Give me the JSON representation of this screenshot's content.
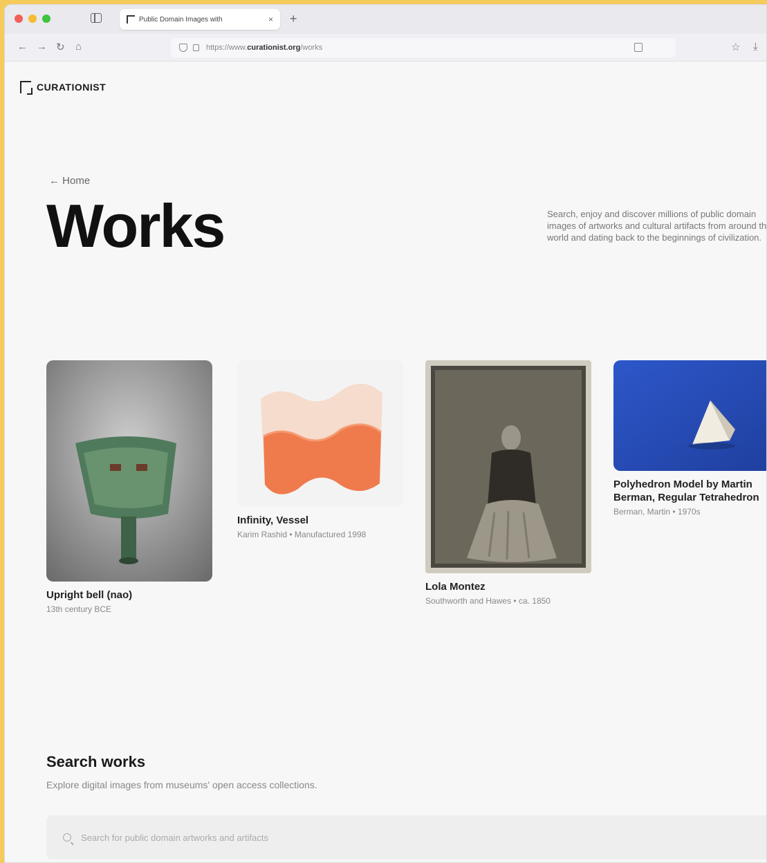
{
  "browser": {
    "tab_title": "Public Domain Images with",
    "tab_close": "×",
    "new_tab": "+",
    "url_prefix": "https://www.",
    "url_domain": "curationist.org",
    "url_suffix": "/works"
  },
  "site": {
    "logo_text": "CURATIONIST"
  },
  "page": {
    "back_link": "← Home",
    "title": "Works",
    "intro": "Search, enjoy and discover millions of public domain images of artworks and cultural artifacts from around the world and dating back to the beginnings of civilization."
  },
  "works": [
    {
      "title": "Upright bell (nao)",
      "meta": "13th century BCE"
    },
    {
      "title": "Infinity, Vessel",
      "meta": "Karim Rashid • Manufactured 1998"
    },
    {
      "title": "Lola Montez",
      "meta": "Southworth and Hawes • ca. 1850"
    },
    {
      "title": "Polyhedron Model by Martin Berman, Regular Tetrahedron",
      "meta": "Berman, Martin • 1970s"
    }
  ],
  "search": {
    "heading": "Search works",
    "subtitle": "Explore digital images from museums' open access collections.",
    "placeholder": "Search for public domain artworks and artifacts"
  }
}
